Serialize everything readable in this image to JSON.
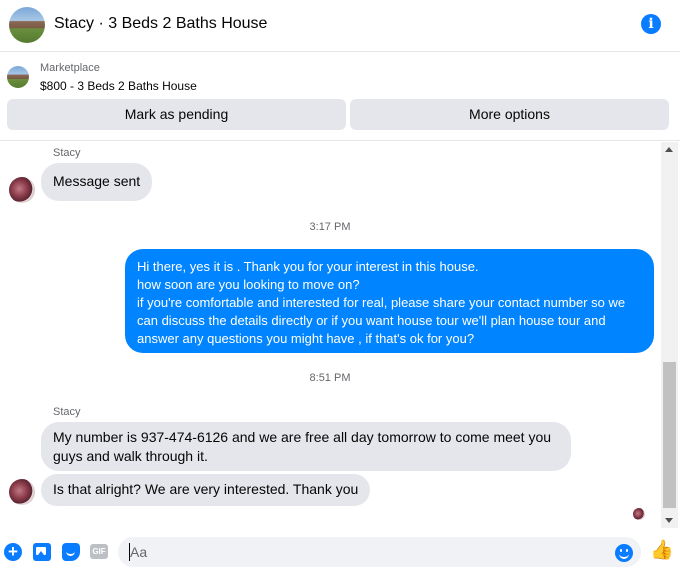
{
  "header": {
    "title": "Stacy · 3 Beds 2 Baths House",
    "info_icon": "info-icon"
  },
  "listing": {
    "label": "Marketplace",
    "price_title": "$800 - 3 Beds 2 Baths House",
    "pending_label": "Mark as pending",
    "more_label": "More options"
  },
  "messages": {
    "sender_1": "Stacy",
    "msg_sent": "Message sent",
    "time_1": "3:17 PM",
    "out_lines": [
      "Hi there, yes it is . Thank you for your interest in this house.",
      "how soon are you looking to move on?",
      "if you're comfortable and interested for real, please share your contact number so we",
      "can discuss the details directly or if you  want house tour we'll plan house tour and",
      "answer any questions you might have , if that's ok for you?"
    ],
    "time_2": "8:51 PM",
    "sender_2": "Stacy",
    "in_lines": [
      "My number is 937-474-6126 and we are free all day tomorrow to come meet you",
      "guys and walk through it."
    ],
    "in_last": "Is that alright? We are very interested. Thank you"
  },
  "composer": {
    "placeholder": "Aa",
    "gif_label": "GIF",
    "icons": [
      "plus-icon",
      "photo-icon",
      "sticker-icon",
      "gif-icon",
      "emoji-icon",
      "like-icon"
    ]
  },
  "colors": {
    "accent": "#0084ff",
    "incoming_bubble": "#e4e6eb",
    "secondary_text": "#65676b"
  }
}
